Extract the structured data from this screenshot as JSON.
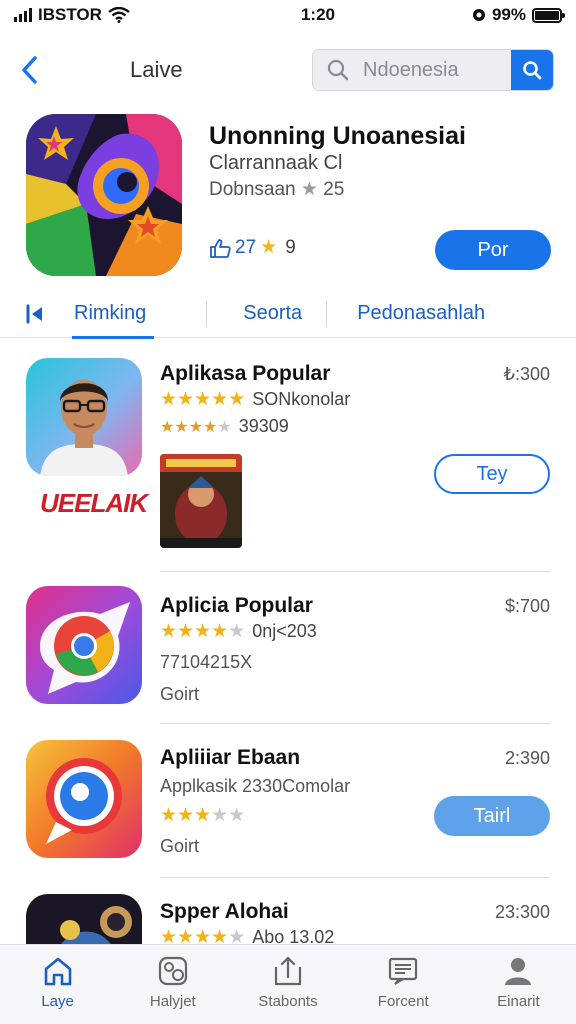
{
  "status_bar": {
    "carrier": "IBSTOR",
    "time": "1:20",
    "battery_percent": "99%",
    "battery_level": 0.99
  },
  "header": {
    "title": "Laive",
    "search_placeholder": "Ndoenesia"
  },
  "featured": {
    "title": "Unonning Unoanesiai",
    "subtitle": "Clarrannaak Cl",
    "meta_text": "Dobnsaan",
    "meta_rating": "25",
    "stats_value": "27",
    "stats_extra": "9",
    "button_label": "Por"
  },
  "tabs": [
    {
      "label": "Rimking"
    },
    {
      "label": "Seorta"
    },
    {
      "label": "Pedonasahlah"
    }
  ],
  "apps": [
    {
      "name": "Aplikasa Popular",
      "price": "₺:300",
      "rating_text": "SONkonolar",
      "rating": 4.5,
      "line2": "39309",
      "line2_rating": 3.5,
      "logo_text": "UEELAIK",
      "button_label": "Tey"
    },
    {
      "name": "Aplicia Popular",
      "price": "$:700",
      "rating_text": "0nj<203",
      "rating": 4,
      "line2": "77104215X",
      "line3": "Goirt"
    },
    {
      "name": "Apliiiar Ebaan",
      "price": "2:390",
      "line1": "Applkasik 2330Comolar",
      "rating": 3,
      "line3": "Goirt",
      "button_label": "Tairl"
    },
    {
      "name": "Spper Alohai",
      "price": "23:300",
      "rating_text": "Abo 13.02",
      "rating": 3.5
    }
  ],
  "tabbar": [
    {
      "label": "Laye",
      "icon": "home-icon"
    },
    {
      "label": "Halyjet",
      "icon": "games-icon"
    },
    {
      "label": "Stabonts",
      "icon": "updates-icon"
    },
    {
      "label": "Forcent",
      "icon": "news-icon"
    },
    {
      "label": "Einarit",
      "icon": "profile-icon"
    }
  ],
  "colors": {
    "accent": "#1874e8",
    "star": "#f2b318",
    "link": "#1a5fc4"
  }
}
